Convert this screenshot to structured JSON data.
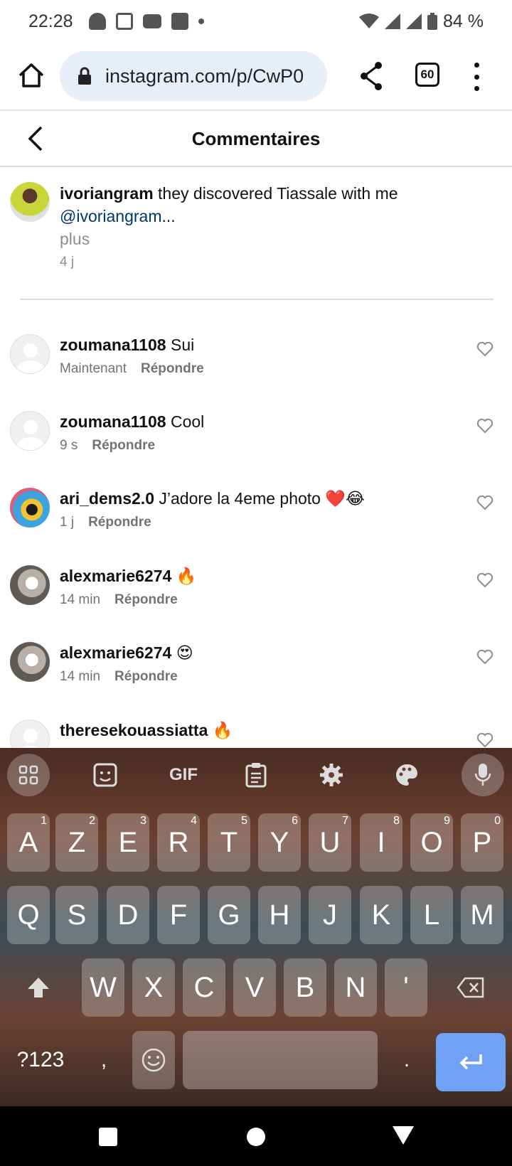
{
  "status_bar": {
    "time": "22:28",
    "battery": "84 %"
  },
  "browser": {
    "url": "instagram.com/p/CwP0",
    "tab_count": "60"
  },
  "header": {
    "title": "Commentaires"
  },
  "caption": {
    "username": "ivoriangram",
    "text": " they discovered Tiassale with me",
    "mention": "@ivoriangram",
    "ellipsis": "...",
    "more": "plus",
    "time": "4 j"
  },
  "comments": [
    {
      "username": "zoumana1108",
      "text": " Sui",
      "time": "Maintenant",
      "reply": "Répondre"
    },
    {
      "username": "zoumana1108",
      "text": " Cool",
      "time": "9 s",
      "reply": "Répondre"
    },
    {
      "username": "ari_dems2.0",
      "text": " J’adore la 4eme photo ❤️😂",
      "time": "1 j",
      "reply": "Répondre"
    },
    {
      "username": "alexmarie6274",
      "text": " 🔥",
      "time": "14 min",
      "reply": "Répondre"
    },
    {
      "username": "alexmarie6274",
      "text": " 😍",
      "time": "14 min",
      "reply": "Répondre"
    },
    {
      "username": "theresekouassiatta",
      "text": " 🔥",
      "time": "",
      "reply": ""
    }
  ],
  "keyboard": {
    "toolbar": {
      "gif": "GIF"
    },
    "row1": [
      {
        "k": "A",
        "n": "1"
      },
      {
        "k": "Z",
        "n": "2"
      },
      {
        "k": "E",
        "n": "3"
      },
      {
        "k": "R",
        "n": "4"
      },
      {
        "k": "T",
        "n": "5"
      },
      {
        "k": "Y",
        "n": "6"
      },
      {
        "k": "U",
        "n": "7"
      },
      {
        "k": "I",
        "n": "8"
      },
      {
        "k": "O",
        "n": "9"
      },
      {
        "k": "P",
        "n": "0"
      }
    ],
    "row2": [
      "Q",
      "S",
      "D",
      "F",
      "G",
      "H",
      "J",
      "K",
      "L",
      "M"
    ],
    "row3": [
      "W",
      "X",
      "C",
      "V",
      "B",
      "N",
      "'"
    ],
    "symbols": "?123",
    "comma": ",",
    "period": "."
  }
}
